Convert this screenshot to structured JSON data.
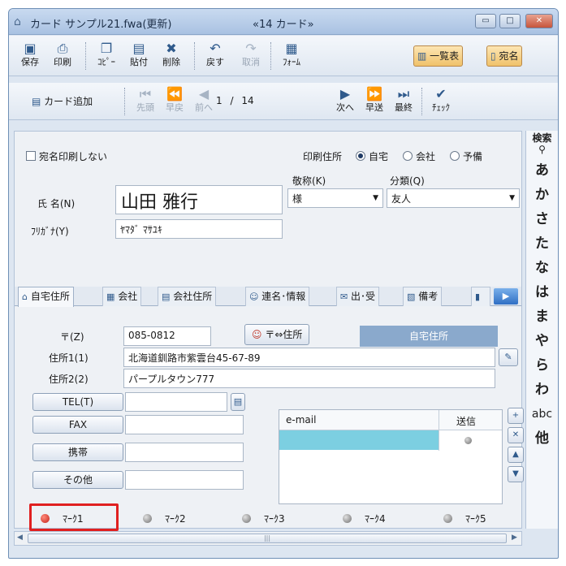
{
  "window": {
    "title": "カード サンプル21.fwa(更新)",
    "subtitle": "«14 カード»",
    "min": "▭",
    "max": "□",
    "close": "✕"
  },
  "toolbar1": {
    "save": "保存",
    "print": "印刷",
    "copy": "ｺﾋﾟｰ",
    "paste": "貼付",
    "delete": "削除",
    "undo": "戻す",
    "cancel": "取消",
    "form": "ﾌｫｰﾑ",
    "list_view": "一覧表",
    "address": "宛名"
  },
  "toolbar2": {
    "add_card": "カード追加",
    "first": "先頭",
    "fast_back": "早戻",
    "prev": "前へ",
    "page_current": "1",
    "page_sep": "/",
    "page_total": "14",
    "next": "次へ",
    "fast_forward": "早送",
    "last": "最終",
    "check": "ﾁｪｯｸ"
  },
  "index": {
    "search": "検索",
    "rows": [
      "あ",
      "か",
      "さ",
      "た",
      "な",
      "は",
      "ま",
      "や",
      "ら",
      "わ",
      "abc",
      "他"
    ]
  },
  "form": {
    "no_address_print": "宛名印刷しない",
    "print_address_label": "印刷住所",
    "print_address_options": [
      "自宅",
      "会社",
      "予備"
    ],
    "print_address_selected": "自宅",
    "honorific_label": "敬称(K)",
    "honorific_value": "様",
    "category_label": "分類(Q)",
    "category_value": "友人",
    "name_label": "氏 名(N)",
    "name_value": "山田 雅行",
    "furigana_label": "ﾌﾘｶﾞﾅ(Y)",
    "furigana_value": "ﾔﾏﾀﾞ ﾏｻﾕｷ"
  },
  "tabs": [
    {
      "label": "自宅住所",
      "icon": "home-icon"
    },
    {
      "label": "会社",
      "icon": "building-icon"
    },
    {
      "label": "会社住所",
      "icon": "office-icon"
    },
    {
      "label": "連名･情報",
      "icon": "people-icon"
    },
    {
      "label": "出･受",
      "icon": "mail-icon"
    },
    {
      "label": "備考",
      "icon": "note-icon"
    }
  ],
  "address": {
    "zip_label": "〒(Z)",
    "zip_value": "085-0812",
    "zip_convert_button": "〒⇔住所",
    "section_badge": "自宅住所",
    "line1_label": "住所1(1)",
    "line1_value": "北海道釧路市紫雲台45-67-89",
    "line2_label": "住所2(2)",
    "line2_value": "パープルタウン777"
  },
  "phones": {
    "tel": "TEL(T)",
    "fax": "FAX",
    "mobile": "携帯",
    "other": "その他"
  },
  "email": {
    "col_address": "e-mail",
    "col_send": "送信"
  },
  "marks": [
    {
      "label": "ﾏｰｸ1",
      "on": true
    },
    {
      "label": "ﾏｰｸ2",
      "on": false
    },
    {
      "label": "ﾏｰｸ3",
      "on": false
    },
    {
      "label": "ﾏｰｸ4",
      "on": false
    },
    {
      "label": "ﾏｰｸ5",
      "on": false
    }
  ],
  "colors": {
    "highlight": "#e02020",
    "selected_row": "#7ccfe1",
    "mark_on": "#c4231b"
  }
}
